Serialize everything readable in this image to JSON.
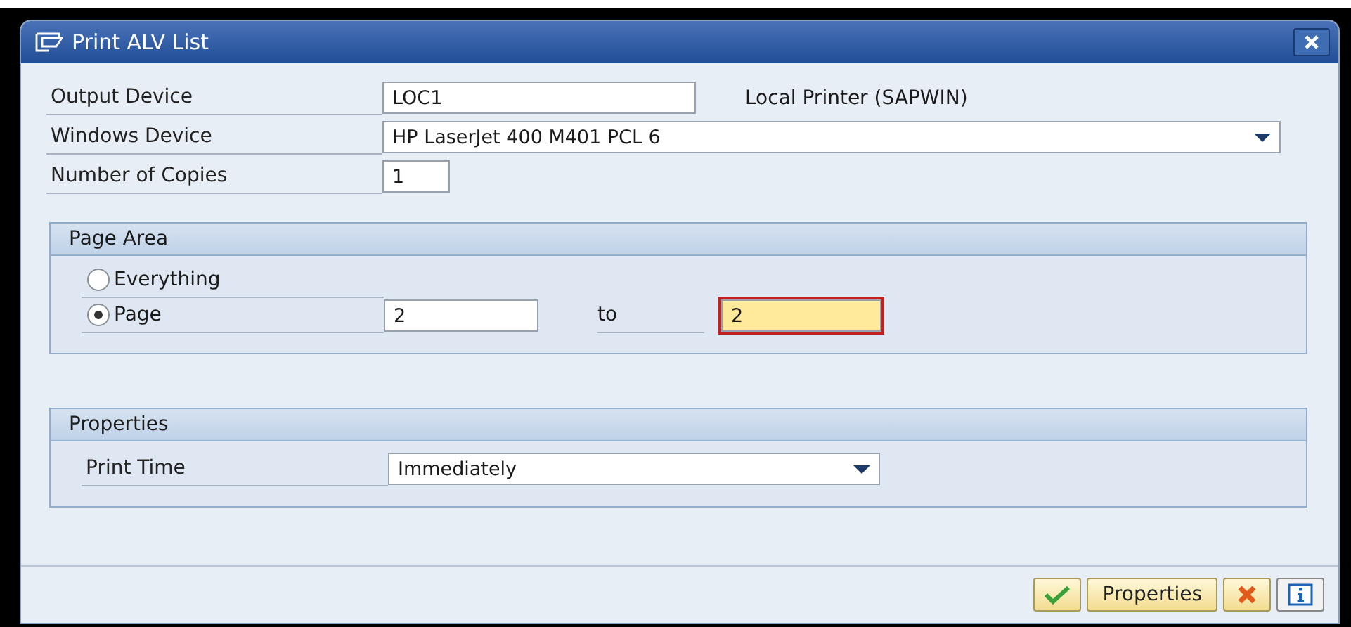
{
  "window": {
    "title": "Print ALV List"
  },
  "fields": [
    {
      "label": "Output Device",
      "kind": "text",
      "value": "LOC1",
      "note": "Local Printer (SAPWIN)"
    },
    {
      "label": "Windows Device",
      "kind": "dropdown",
      "value": "HP LaserJet 400 M401 PCL 6"
    },
    {
      "label": "Number of Copies",
      "kind": "text",
      "value": "1"
    }
  ],
  "page_area": {
    "title": "Page Area",
    "options": [
      {
        "label": "Everything",
        "selected": false
      },
      {
        "label": "Page",
        "selected": true,
        "from": "2",
        "to_label": "to",
        "to": "2",
        "to_focused": true
      }
    ]
  },
  "properties": {
    "title": "Properties",
    "fields": [
      {
        "label": "Print Time",
        "kind": "dropdown",
        "value": "Immediately"
      }
    ]
  },
  "buttons": [
    {
      "kind": "ok"
    },
    {
      "kind": "text",
      "label": "Properties"
    },
    {
      "kind": "cancel"
    },
    {
      "kind": "info"
    }
  ]
}
